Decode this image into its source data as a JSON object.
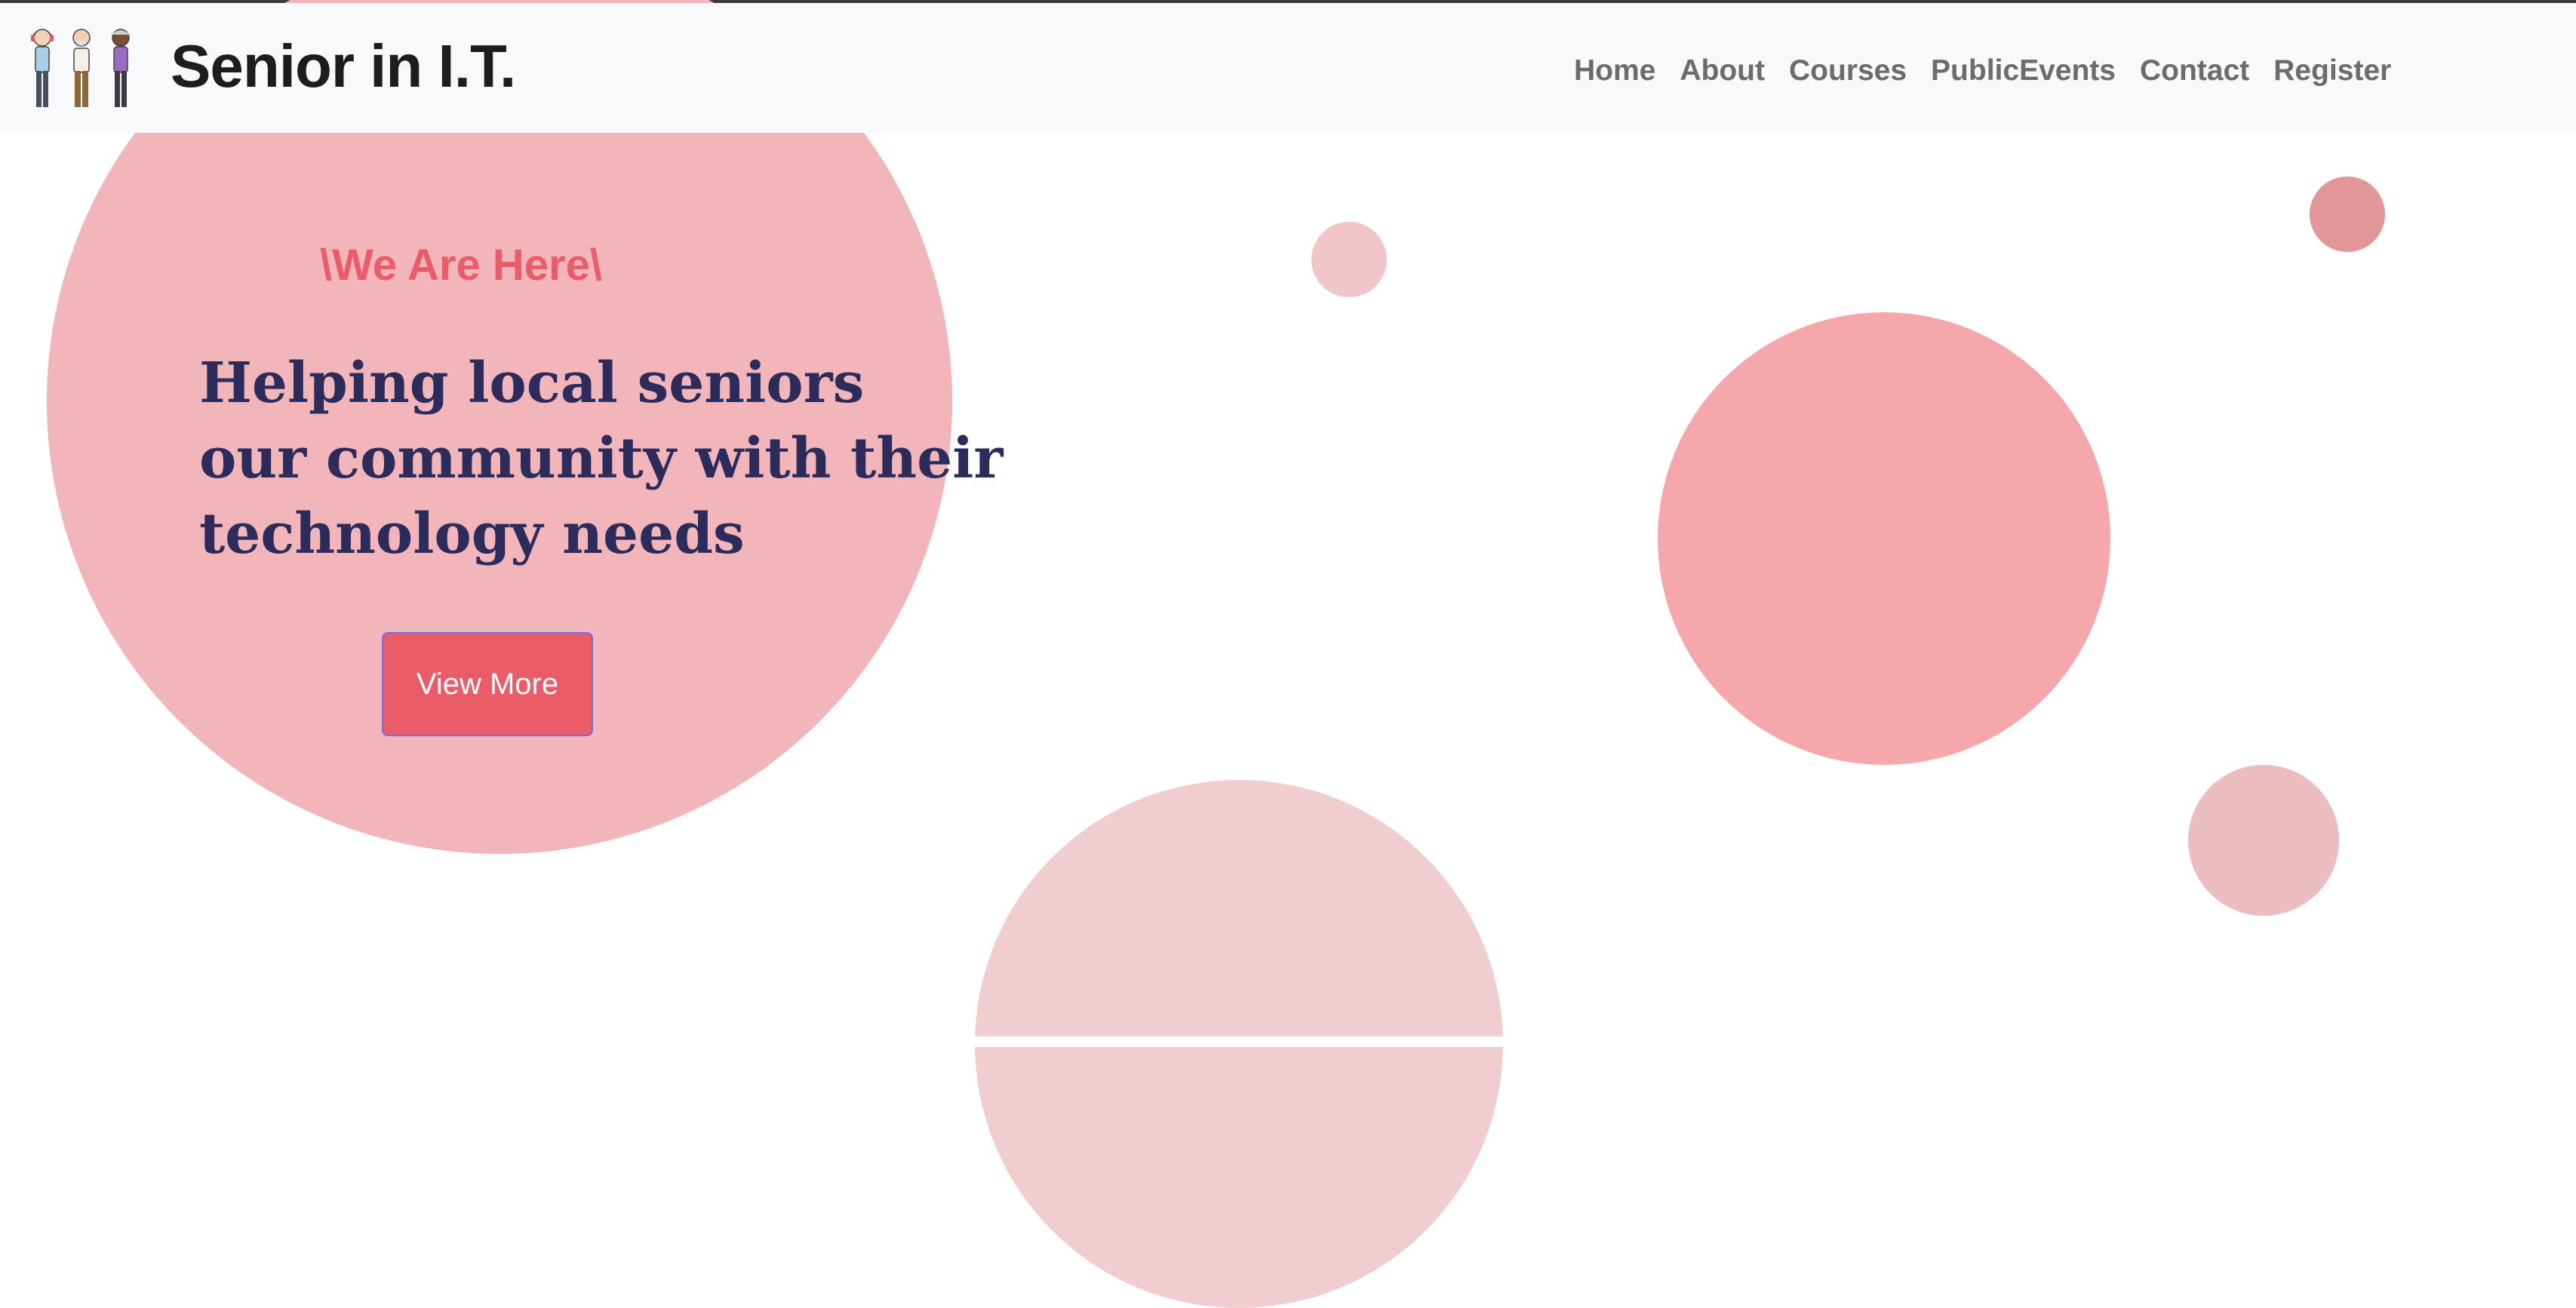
{
  "navbar": {
    "brand": "Senior in I.T.",
    "links": [
      {
        "label": "Home"
      },
      {
        "label": "About"
      },
      {
        "label": "Courses"
      },
      {
        "label": "PublicEvents"
      },
      {
        "label": "Contact"
      },
      {
        "label": "Register"
      }
    ]
  },
  "hero": {
    "tagline": "\\We Are Here\\",
    "headline": [
      "Helping local seniors",
      "our community with their",
      "technology needs"
    ],
    "button_label": "View More"
  },
  "colors": {
    "accent": "#eb5c69",
    "headline": "#2b2c5c",
    "hero_circle": "#f1b5ba",
    "nav_bg": "#f8f9fa"
  }
}
